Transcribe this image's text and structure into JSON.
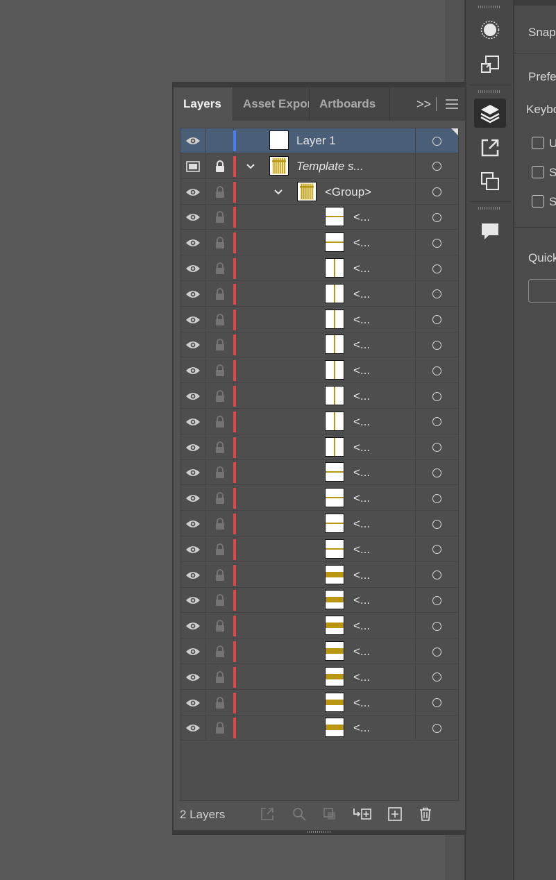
{
  "panel": {
    "tabs": [
      {
        "label": "Layers",
        "active": true
      },
      {
        "label": "Asset Export",
        "active": false
      },
      {
        "label": "Artboards",
        "active": false
      }
    ],
    "overflow_label": ">>",
    "footer_count": "2 Layers"
  },
  "layers": [
    {
      "label": "Layer 1",
      "italic": false,
      "indent": 0,
      "selected": true,
      "color": "#4a7cf0",
      "lock": "none",
      "vis": "eye",
      "expand": "none",
      "thumb": "blank"
    },
    {
      "label": "Template s...",
      "italic": true,
      "indent": 0,
      "selected": false,
      "color": "#e04848",
      "lock": "locked",
      "vis": "template",
      "expand": "open",
      "thumb": "template"
    },
    {
      "label": "<Group>",
      "italic": false,
      "indent": 1,
      "selected": false,
      "color": "#e04848",
      "lock": "dim",
      "vis": "eye",
      "expand": "open",
      "thumb": "template"
    },
    {
      "label": "<...",
      "italic": false,
      "indent": 2,
      "selected": false,
      "color": "#e04848",
      "lock": "dim",
      "vis": "eye",
      "expand": "none",
      "thumb": "hline"
    },
    {
      "label": "<...",
      "italic": false,
      "indent": 2,
      "selected": false,
      "color": "#e04848",
      "lock": "dim",
      "vis": "eye",
      "expand": "none",
      "thumb": "hline"
    },
    {
      "label": "<...",
      "italic": false,
      "indent": 2,
      "selected": false,
      "color": "#e04848",
      "lock": "dim",
      "vis": "eye",
      "expand": "none",
      "thumb": "vline"
    },
    {
      "label": "<...",
      "italic": false,
      "indent": 2,
      "selected": false,
      "color": "#e04848",
      "lock": "dim",
      "vis": "eye",
      "expand": "none",
      "thumb": "vline"
    },
    {
      "label": "<...",
      "italic": false,
      "indent": 2,
      "selected": false,
      "color": "#e04848",
      "lock": "dim",
      "vis": "eye",
      "expand": "none",
      "thumb": "vline"
    },
    {
      "label": "<...",
      "italic": false,
      "indent": 2,
      "selected": false,
      "color": "#e04848",
      "lock": "dim",
      "vis": "eye",
      "expand": "none",
      "thumb": "vline"
    },
    {
      "label": "<...",
      "italic": false,
      "indent": 2,
      "selected": false,
      "color": "#e04848",
      "lock": "dim",
      "vis": "eye",
      "expand": "none",
      "thumb": "vline"
    },
    {
      "label": "<...",
      "italic": false,
      "indent": 2,
      "selected": false,
      "color": "#e04848",
      "lock": "dim",
      "vis": "eye",
      "expand": "none",
      "thumb": "vline"
    },
    {
      "label": "<...",
      "italic": false,
      "indent": 2,
      "selected": false,
      "color": "#e04848",
      "lock": "dim",
      "vis": "eye",
      "expand": "none",
      "thumb": "vline"
    },
    {
      "label": "<...",
      "italic": false,
      "indent": 2,
      "selected": false,
      "color": "#e04848",
      "lock": "dim",
      "vis": "eye",
      "expand": "none",
      "thumb": "vline"
    },
    {
      "label": "<...",
      "italic": false,
      "indent": 2,
      "selected": false,
      "color": "#e04848",
      "lock": "dim",
      "vis": "eye",
      "expand": "none",
      "thumb": "hline"
    },
    {
      "label": "<...",
      "italic": false,
      "indent": 2,
      "selected": false,
      "color": "#e04848",
      "lock": "dim",
      "vis": "eye",
      "expand": "none",
      "thumb": "hline"
    },
    {
      "label": "<...",
      "italic": false,
      "indent": 2,
      "selected": false,
      "color": "#e04848",
      "lock": "dim",
      "vis": "eye",
      "expand": "none",
      "thumb": "hline"
    },
    {
      "label": "<...",
      "italic": false,
      "indent": 2,
      "selected": false,
      "color": "#e04848",
      "lock": "dim",
      "vis": "eye",
      "expand": "none",
      "thumb": "hline"
    },
    {
      "label": "<...",
      "italic": false,
      "indent": 2,
      "selected": false,
      "color": "#e04848",
      "lock": "dim",
      "vis": "eye",
      "expand": "none",
      "thumb": "hbar"
    },
    {
      "label": "<...",
      "italic": false,
      "indent": 2,
      "selected": false,
      "color": "#e04848",
      "lock": "dim",
      "vis": "eye",
      "expand": "none",
      "thumb": "hbar"
    },
    {
      "label": "<...",
      "italic": false,
      "indent": 2,
      "selected": false,
      "color": "#e04848",
      "lock": "dim",
      "vis": "eye",
      "expand": "none",
      "thumb": "hbar"
    },
    {
      "label": "<...",
      "italic": false,
      "indent": 2,
      "selected": false,
      "color": "#e04848",
      "lock": "dim",
      "vis": "eye",
      "expand": "none",
      "thumb": "hbar"
    },
    {
      "label": "<...",
      "italic": false,
      "indent": 2,
      "selected": false,
      "color": "#e04848",
      "lock": "dim",
      "vis": "eye",
      "expand": "none",
      "thumb": "hbar"
    },
    {
      "label": "<...",
      "italic": false,
      "indent": 2,
      "selected": false,
      "color": "#e04848",
      "lock": "dim",
      "vis": "eye",
      "expand": "none",
      "thumb": "hbar"
    },
    {
      "label": "<...",
      "italic": false,
      "indent": 2,
      "selected": false,
      "color": "#e04848",
      "lock": "dim",
      "vis": "eye",
      "expand": "none",
      "thumb": "hbar"
    }
  ],
  "toolstrip": [
    {
      "icon": "appearance-icon",
      "active": false
    },
    {
      "icon": "transform-icon",
      "active": false
    },
    {
      "icon": "layers-icon",
      "active": true
    },
    {
      "icon": "export-icon",
      "active": false
    },
    {
      "icon": "artboards-icon",
      "active": false
    },
    {
      "icon": "comments-icon",
      "active": false
    }
  ],
  "properties": {
    "snap_label": "Snap",
    "prefs_label": "Prefe",
    "keyboard_label": "Keybo",
    "checkboxes": [
      "U",
      "S",
      "S"
    ],
    "quick_label": "Quick"
  },
  "colors": {
    "accent_blue": "#4a7cf0",
    "layer_red": "#e04848",
    "thumb_gold": "#b8960f",
    "selection": "#4a5e78"
  }
}
